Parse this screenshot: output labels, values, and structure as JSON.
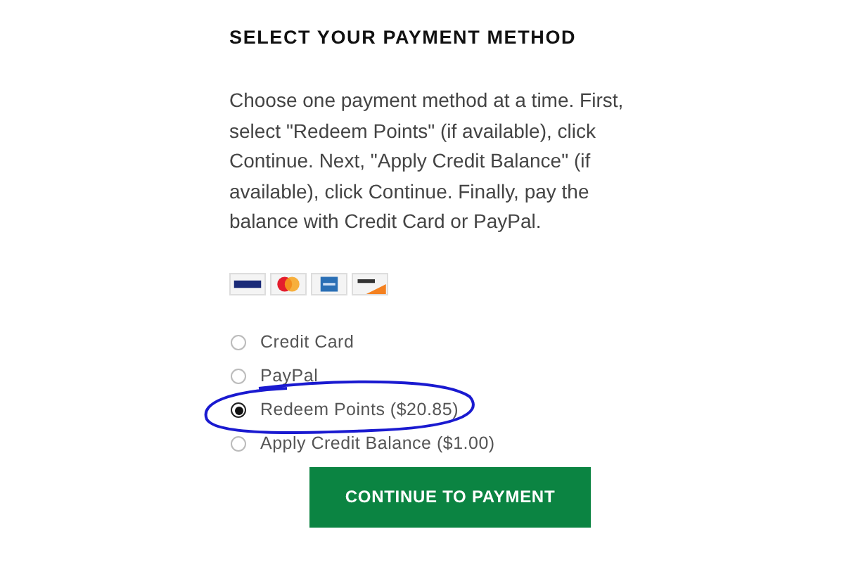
{
  "heading": "SELECT YOUR PAYMENT METHOD",
  "instructions": "Choose one payment method at a time. First, select \"Redeem Points\" (if available), click Continue. Next, \"Apply Credit Balance\" (if available), click Continue. Finally, pay the balance with Credit Card or PayPal.",
  "card_logos": [
    {
      "kind": "visa"
    },
    {
      "kind": "mastercard"
    },
    {
      "kind": "amex"
    },
    {
      "kind": "discover"
    }
  ],
  "options": [
    {
      "label": "Credit Card",
      "selected": false,
      "circled": false
    },
    {
      "label": "PayPal",
      "selected": false,
      "circled": false
    },
    {
      "label": "Redeem Points ($20.85)",
      "selected": true,
      "circled": true
    },
    {
      "label": "Apply Credit Balance ($1.00)",
      "selected": false,
      "circled": false
    }
  ],
  "button": "CONTINUE TO PAYMENT"
}
